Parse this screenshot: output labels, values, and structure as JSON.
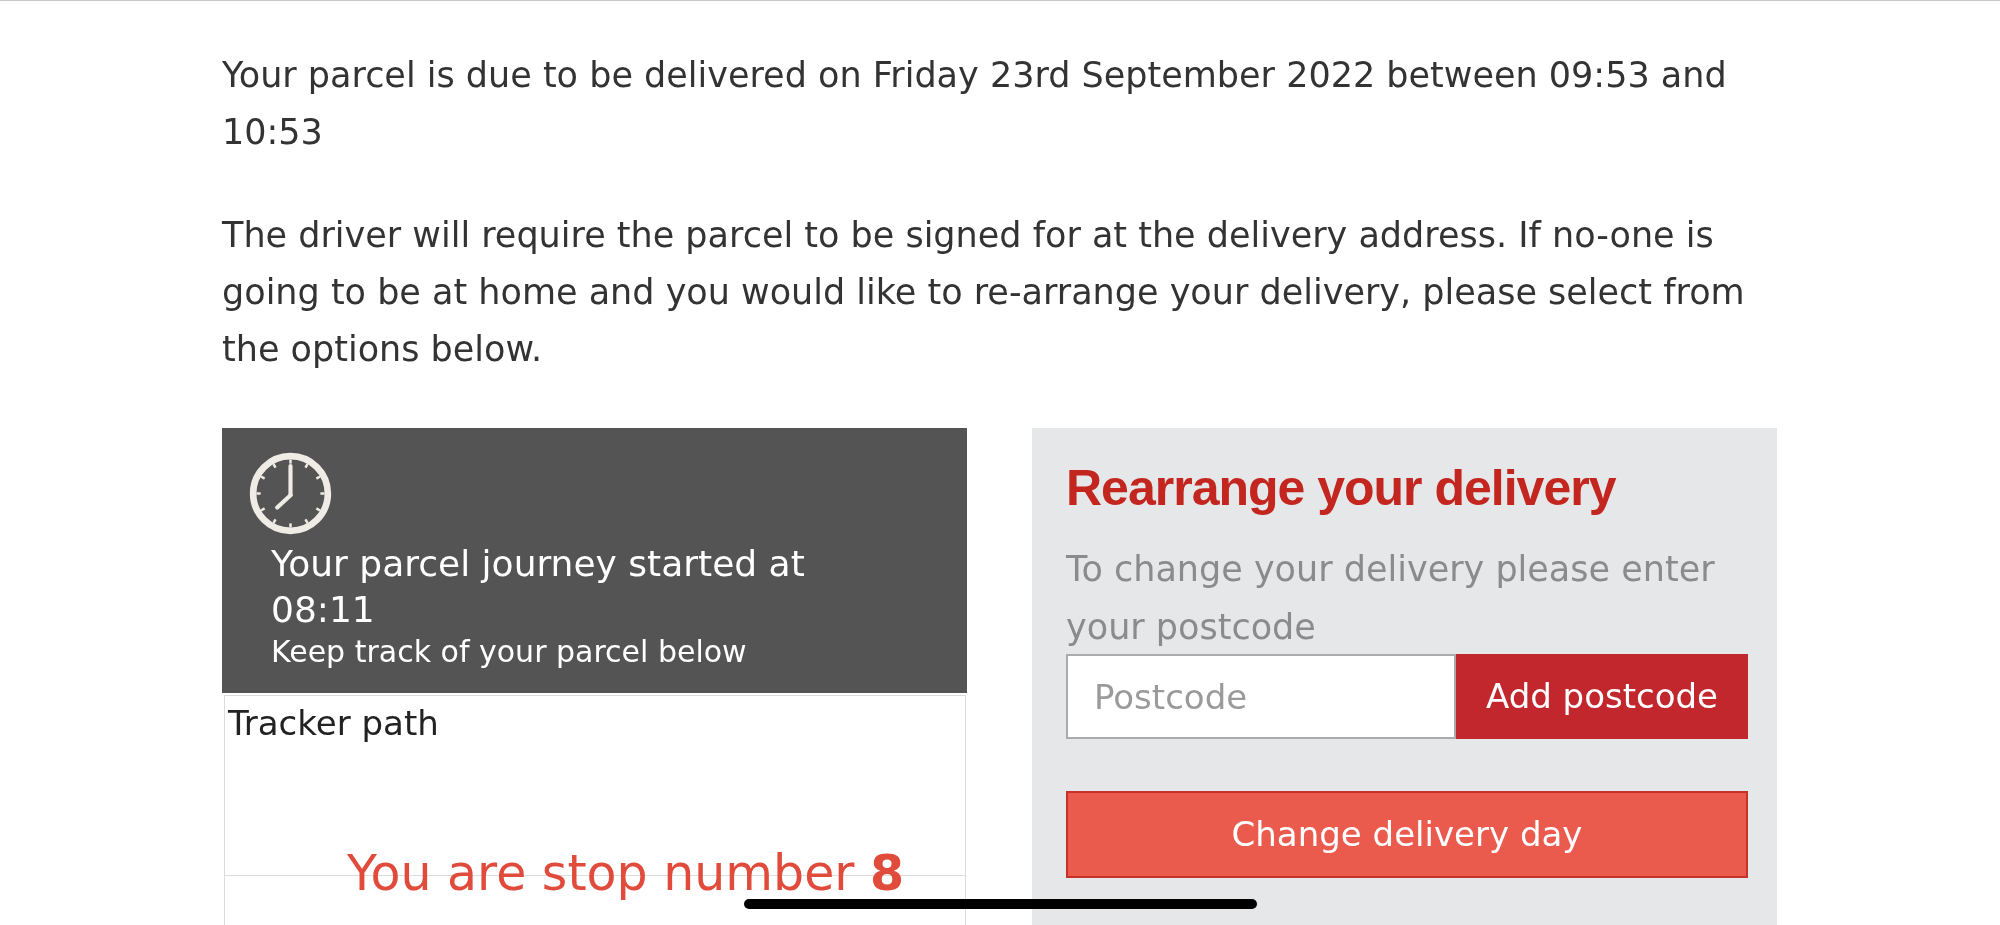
{
  "delivery_info": {
    "paragraphs": [
      "Your parcel is due to be delivered on Friday 23rd September 2022 between 09:53 and 10:53",
      "The driver will require the parcel to be signed for at the delivery address. If no-one is going to be at home and you would like to re-arrange your delivery, please select from the options below."
    ]
  },
  "journey_panel": {
    "title": "Your parcel journey started at 08:11",
    "subtitle": "Keep track of your parcel below",
    "tracker_label": "Tracker path",
    "stop_message": "You are stop number **8**"
  },
  "rearrange_panel": {
    "title": "Rearrange your delivery",
    "instructions": "To change your delivery please enter your postcode",
    "postcode_field": {
      "placeholder": "Postcode"
    },
    "add_button": "Add postcode",
    "change_day_button": "Change delivery day"
  }
}
